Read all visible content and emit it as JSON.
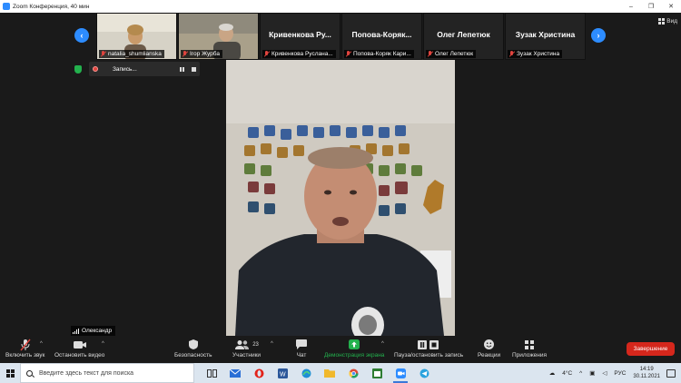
{
  "window": {
    "title": "Zoom Конференция, 40 мин"
  },
  "gallery": {
    "tiles": [
      {
        "label": "natalia_shumlianska",
        "big_name": "",
        "muted": true
      },
      {
        "label": "Ігор Журба",
        "big_name": "",
        "muted": true
      },
      {
        "label": "Кривенкова Руслана...",
        "big_name": "Кривенкова  Ру...",
        "muted": true
      },
      {
        "label": "Попова-Коряк Кари...",
        "big_name": "Попова-Коряк...",
        "muted": true
      },
      {
        "label": "Олег Лепетюк",
        "big_name": "Олег Лепетюк",
        "muted": true
      },
      {
        "label": "Зузак Христина",
        "big_name": "Зузак Христина",
        "muted": true
      }
    ],
    "prev_icon": "chevron-left-icon",
    "next_icon": "chevron-right-icon",
    "view_label": "Вид"
  },
  "recording": {
    "label": "Запись..."
  },
  "active_speaker": {
    "name": "Олександр"
  },
  "toolbar": {
    "unmute": "Включить звук",
    "stop_video": "Остановить видео",
    "security": "Безопасность",
    "participants": "Участники",
    "participants_count": "23",
    "chat": "Чат",
    "share": "Демонстрация экрана",
    "pause_record": "Пауза/остановить запись",
    "reactions": "Реакции",
    "apps": "Приложения",
    "end": "Завершение"
  },
  "taskbar": {
    "search_placeholder": "Введите здесь текст для поиска",
    "weather": "4°C",
    "lang": "РУС",
    "time": "14:19",
    "date": "30.11.2021"
  },
  "colors": {
    "accent": "#2d8cff",
    "danger": "#d5271c",
    "share_green": "#23b14d"
  }
}
